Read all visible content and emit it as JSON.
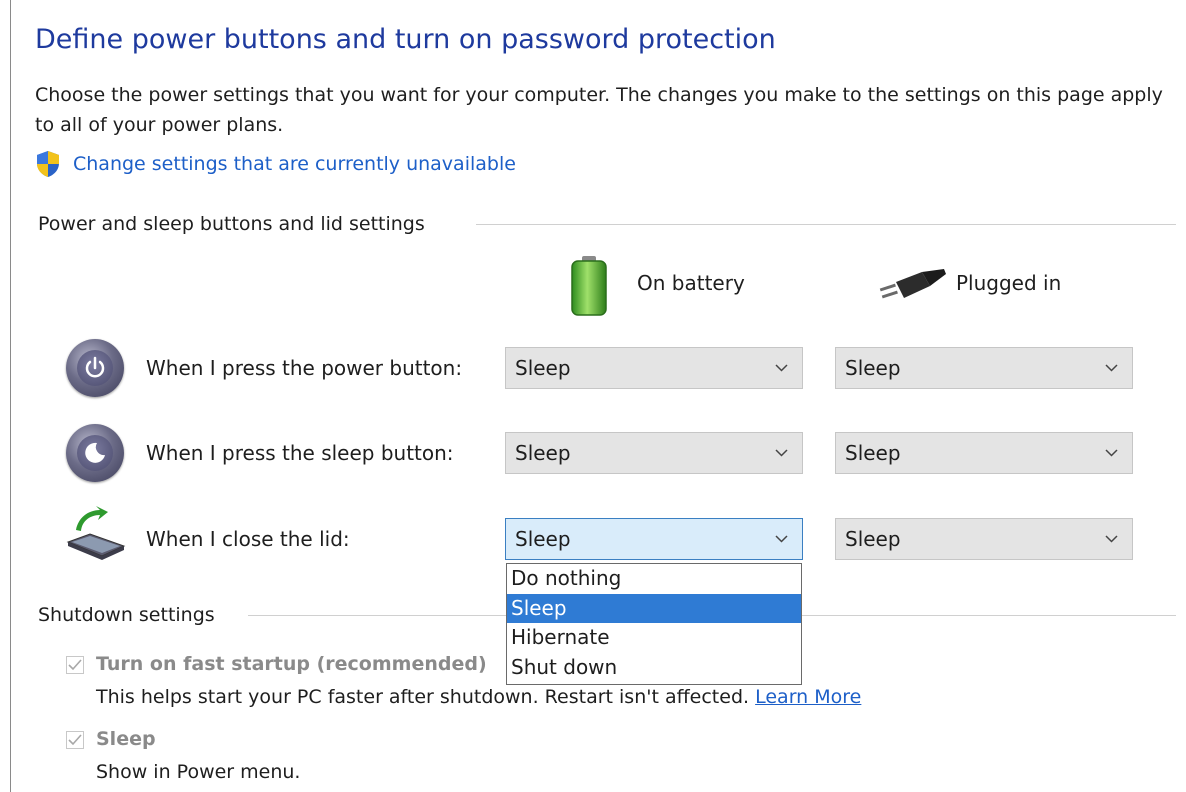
{
  "header": {
    "title": "Define power buttons and turn on password protection",
    "description": "Choose the power settings that you want for your computer. The changes you make to the settings on this page apply to all of your power plans.",
    "change_settings_link": "Change settings that are currently unavailable"
  },
  "power_section": {
    "label": "Power and sleep buttons and lid settings",
    "columns": {
      "battery": "On battery",
      "plugged": "Plugged in"
    },
    "rows": [
      {
        "label": "When I press the power button:",
        "battery": "Sleep",
        "plugged": "Sleep",
        "icon": "power-button-icon"
      },
      {
        "label": "When I press the sleep button:",
        "battery": "Sleep",
        "plugged": "Sleep",
        "icon": "sleep-button-icon"
      },
      {
        "label": "When I close the lid:",
        "battery": "Sleep",
        "plugged": "Sleep",
        "icon": "laptop-lid-icon"
      }
    ],
    "open_dropdown": {
      "options": [
        "Do nothing",
        "Sleep",
        "Hibernate",
        "Shut down"
      ],
      "selected": "Sleep"
    }
  },
  "shutdown_section": {
    "label": "Shutdown settings",
    "fast_startup": {
      "label": "Turn on fast startup (recommended)",
      "checked": true,
      "description": "This helps start your PC faster after shutdown. Restart isn't affected.",
      "learn_more": "Learn More"
    },
    "sleep": {
      "label": "Sleep",
      "checked": true,
      "description": "Show in Power menu."
    }
  },
  "colors": {
    "title": "#1e3a9e",
    "link": "#1d5fc8",
    "selected_option": "#2f7bd4",
    "open_select": "#d9ecfa"
  }
}
